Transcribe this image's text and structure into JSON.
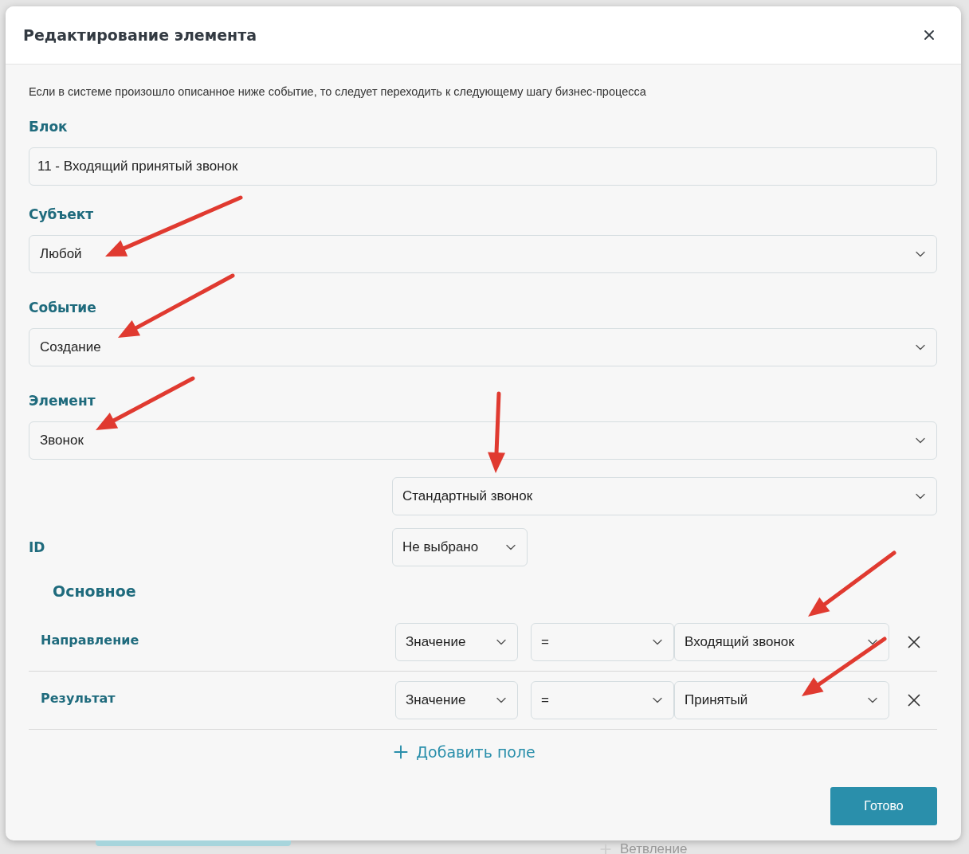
{
  "dialog": {
    "title": "Редактирование элемента",
    "intro": "Если в системе произошло описанное ниже событие, то следует переходить к следующему шагу бизнес-процесса",
    "fields": [
      {
        "label": "Блок",
        "kind": "text",
        "value": "11 - Входящий принятый звонок"
      },
      {
        "label": "Субъект",
        "kind": "select",
        "value": "Любой"
      },
      {
        "label": "Событие",
        "kind": "select",
        "value": "Создание"
      },
      {
        "label": "Элемент",
        "kind": "select",
        "value": "Звонок"
      }
    ],
    "subtype": {
      "value": "Стандартный звонок"
    },
    "id_field": {
      "label": "ID",
      "value": "Не выбрано"
    },
    "section": "Основное",
    "conditions": [
      {
        "label": "Направление",
        "source": "Значение",
        "operator": "=",
        "value": "Входящий звонок"
      },
      {
        "label": "Результат",
        "source": "Значение",
        "operator": "=",
        "value": "Принятый"
      }
    ],
    "add_button": "Добавить поле",
    "submit": "Готово"
  },
  "background": {
    "item": "Ветвление"
  }
}
